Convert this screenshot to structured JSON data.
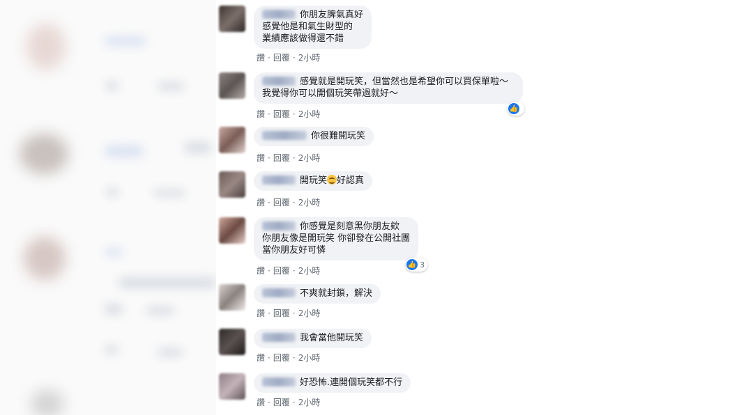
{
  "comments": [
    {
      "lines": [
        "你朋友脾氣真好",
        "感覺他是和氣生財型的",
        "業績應該做得還不錯"
      ],
      "actions": [
        "讚",
        "回覆",
        "2小時"
      ]
    },
    {
      "lines": [
        "感覺就是開玩笑，但當然也是希望你可以買保單啦～",
        "我覺得你可以開個玩笑帶過就好～"
      ],
      "actions": [
        "讚",
        "回覆",
        "2小時"
      ],
      "reactions": ""
    },
    {
      "lines": [
        "你很難開玩笑"
      ],
      "actions": [
        "讚",
        "回覆",
        "2小時"
      ]
    },
    {
      "lines_before": "開玩笑",
      "lines_after": "好認真",
      "emoji": "grinning-squinting-emoji",
      "actions": [
        "讚",
        "回覆",
        "2小時"
      ]
    },
    {
      "lines": [
        "你感覺是刻意黑你朋友欸",
        "你朋友像是開玩笑 你卻發在公開社團",
        "當你朋友好可憐"
      ],
      "actions": [
        "讚",
        "回覆",
        "2小時"
      ],
      "reactions": "3"
    },
    {
      "lines": [
        "不爽就封鎖，解決"
      ],
      "actions": [
        "讚",
        "回覆",
        "2小時"
      ]
    },
    {
      "lines": [
        "我會當他開玩笑"
      ],
      "actions": [
        "讚",
        "回覆",
        "2小時"
      ]
    },
    {
      "lines": [
        "好恐怖.連開個玩笑都不行"
      ],
      "actions": [
        "讚",
        "回覆",
        "2小時"
      ]
    }
  ],
  "icons": {
    "like": "thumbs-up-icon"
  },
  "colors": {
    "bubble": "#f0f2f5",
    "like": "#1877f2",
    "meta": "#606770"
  }
}
